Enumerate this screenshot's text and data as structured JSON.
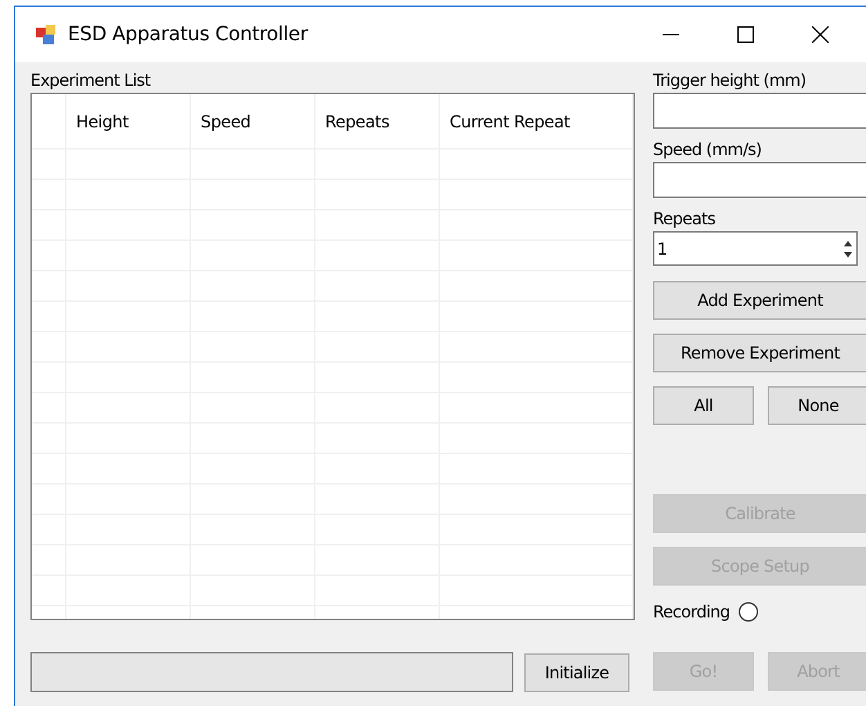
{
  "window": {
    "title": "ESD Apparatus Controller"
  },
  "experiment_list": {
    "label": "Experiment List",
    "columns": [
      "Height",
      "Speed",
      "Repeats",
      "Current Repeat"
    ]
  },
  "trigger_height": {
    "label": "Trigger height (mm)"
  },
  "speed": {
    "label": "Speed (mm/s)"
  },
  "repeats": {
    "label": "Repeats",
    "value": "1"
  },
  "buttons": [
    {
      "label": "Add Experiment",
      "disabled": false
    },
    {
      "label": "Remove Experiment",
      "disabled": false
    }
  ],
  "select_buttons": [
    {
      "label": "All",
      "disabled": false
    },
    {
      "label": "None",
      "disabled": false
    }
  ],
  "setup_buttons": [
    {
      "label": "Calibrate",
      "disabled": true
    },
    {
      "label": "Scope Setup",
      "disabled": true
    }
  ],
  "recording": {
    "label": "Recording",
    "checked": false
  },
  "initialize": {
    "label": "Initialize",
    "disabled": false
  },
  "run_buttons": [
    {
      "label": "Go!",
      "disabled": true
    },
    {
      "label": "Abort",
      "disabled": true
    }
  ]
}
